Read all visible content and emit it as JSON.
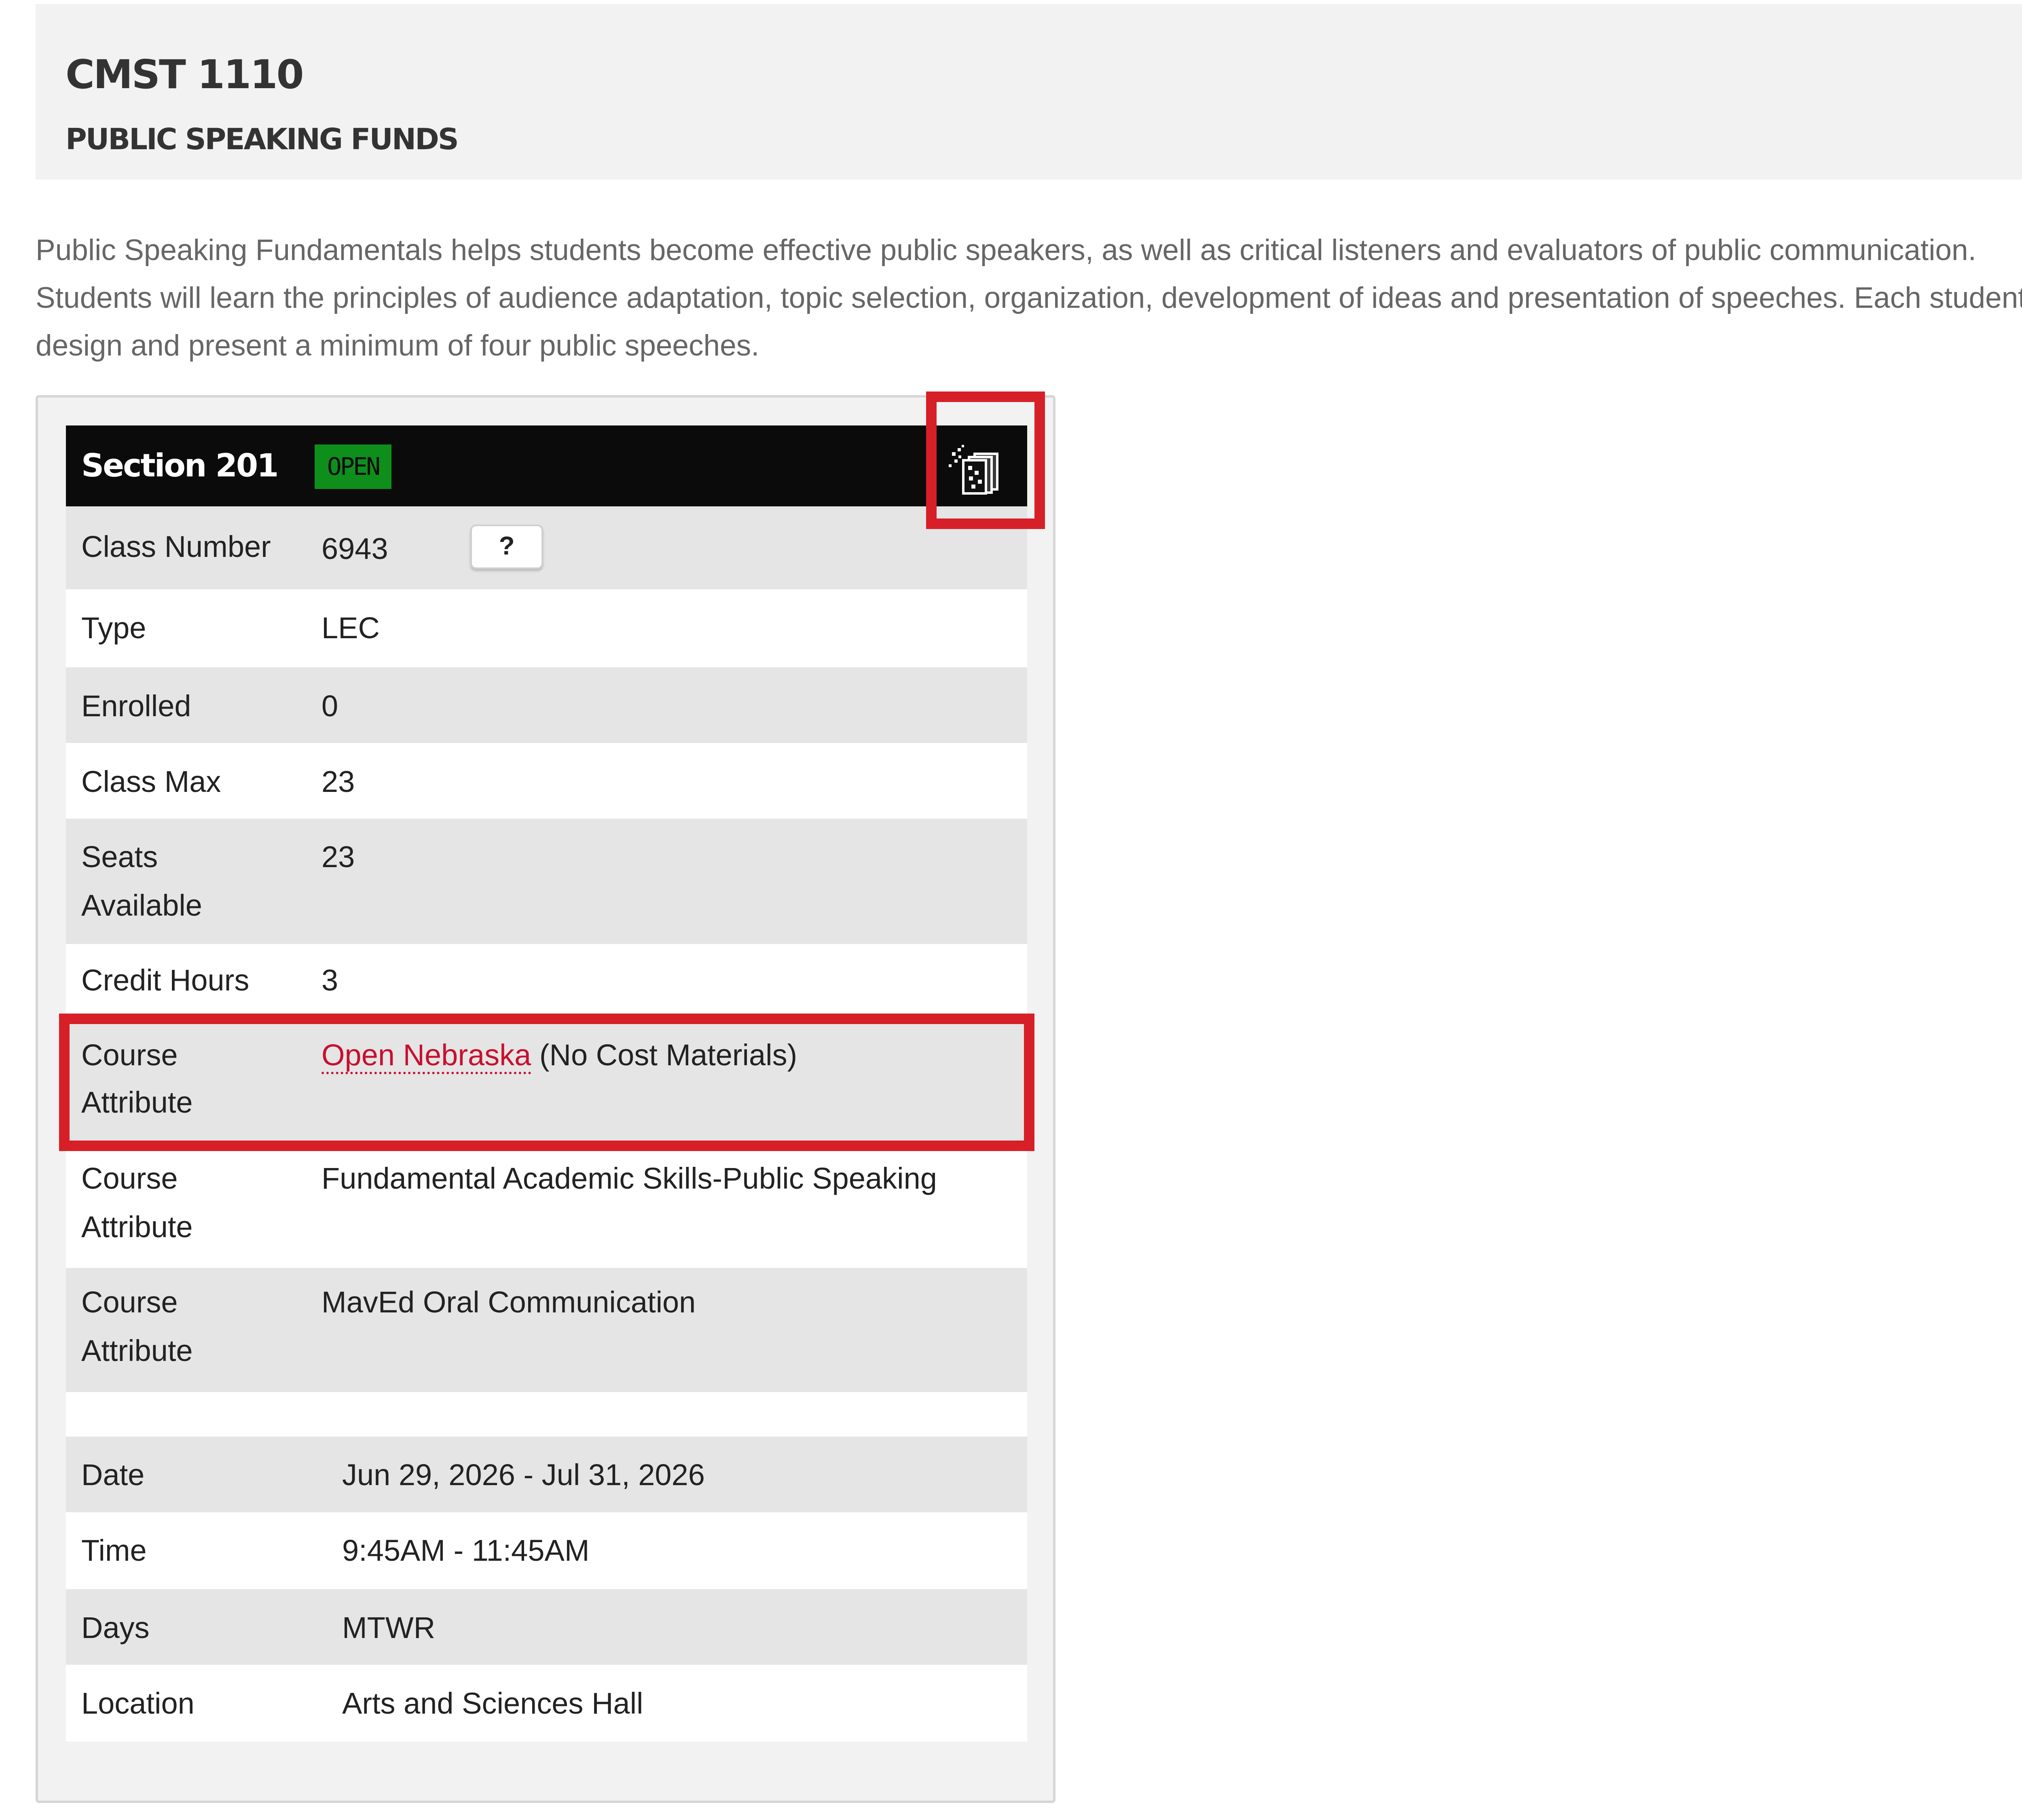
{
  "course": {
    "code": "CMST 1110",
    "title": "PUBLIC SPEAKING FUNDS",
    "description": "Public Speaking Fundamentals helps students become effective public speakers, as well as critical listeners and evaluators of public communication. Students will learn the principles of audience adaptation, topic selection, organization, development of ideas and presentation of speeches. Each student will design and present a minimum of four public speeches."
  },
  "section": {
    "label": "Section 201",
    "status": "OPEN",
    "status_color": "#0e8f1b",
    "book_icon": "textbook-icon",
    "highlight_color": "#d71f27",
    "class_number_label": "Class Number",
    "class_number": "6943",
    "help_label": "?",
    "type_label": "Type",
    "type": "LEC",
    "enrolled_label": "Enrolled",
    "enrolled": "0",
    "class_max_label": "Class Max",
    "class_max": "23",
    "seats_label_1": "Seats",
    "seats_label_2": "Available",
    "seats_available": "23",
    "credit_hours_label": "Credit Hours",
    "credit_hours": "3",
    "attributes": [
      {
        "label_1": "Course",
        "label_2": "Attribute",
        "link_text": "Open Nebraska",
        "value": "(No Cost Materials)"
      },
      {
        "label_1": "Course",
        "label_2": "Attribute",
        "value": "Fundamental Academic Skills-Public Speaking"
      },
      {
        "label_1": "Course",
        "label_2": "Attribute",
        "value": "MavEd Oral Communication"
      }
    ],
    "schedule": {
      "date_label": "Date",
      "date": "Jun 29, 2026 - Jul 31, 2026",
      "time_label": "Time",
      "time": "9:45AM - 11:45AM",
      "days_label": "Days",
      "days": "MTWR",
      "location_label": "Location",
      "location": "Arts and Sciences Hall"
    }
  }
}
